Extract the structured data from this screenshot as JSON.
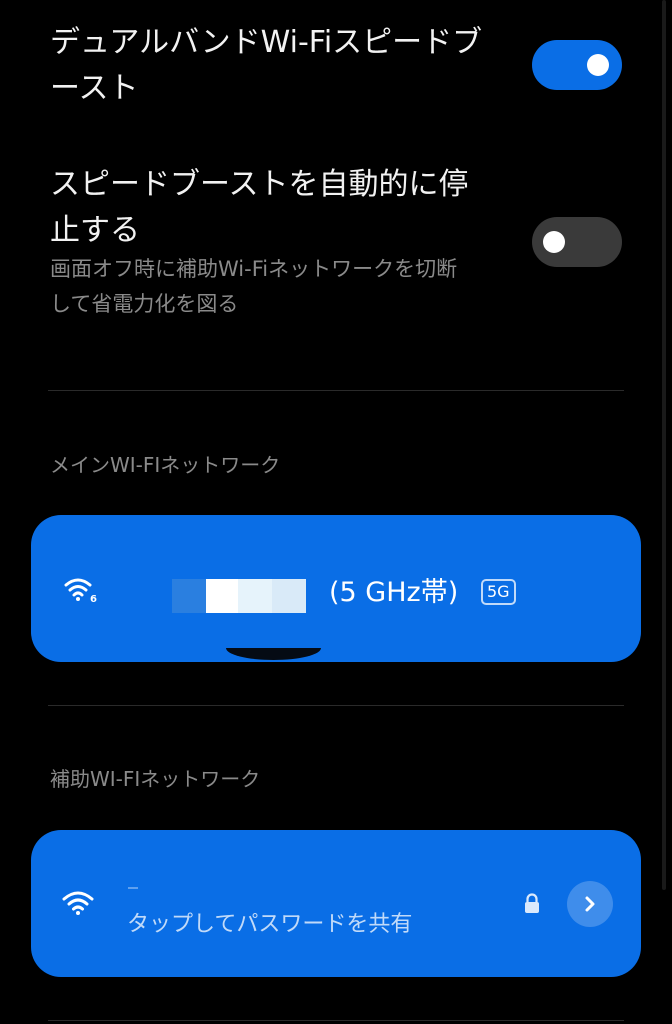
{
  "settings": {
    "dual_band_boost": {
      "title_line1": "デュアルバンドWi-Fiスピードブ",
      "title_line2": "ースト",
      "enabled": true
    },
    "auto_stop_boost": {
      "title_line1": "スピードブーストを自動的に停",
      "title_line2": "止する",
      "desc_line1": "画面オフ時に補助Wi-Fiネットワークを切断",
      "desc_line2": "して省電力化を図る",
      "enabled": false
    }
  },
  "main_network": {
    "header": "メインWI-FIネットワーク",
    "band_label": "(5 GHz帯)",
    "band_badge": "5G",
    "wifi_generation": "6",
    "icon": "wifi-6-icon"
  },
  "aux_network": {
    "header": "補助WI-FIネットワーク",
    "subtitle": "タップしてパスワードを共有",
    "icon": "wifi-icon",
    "lock_icon": "lock-icon",
    "chevron_icon": "chevron-right-icon"
  },
  "colors": {
    "accent": "#0a6ee6",
    "background": "#000000",
    "text_secondary": "#8a8a8a",
    "toggle_off": "#3a3a3a"
  }
}
